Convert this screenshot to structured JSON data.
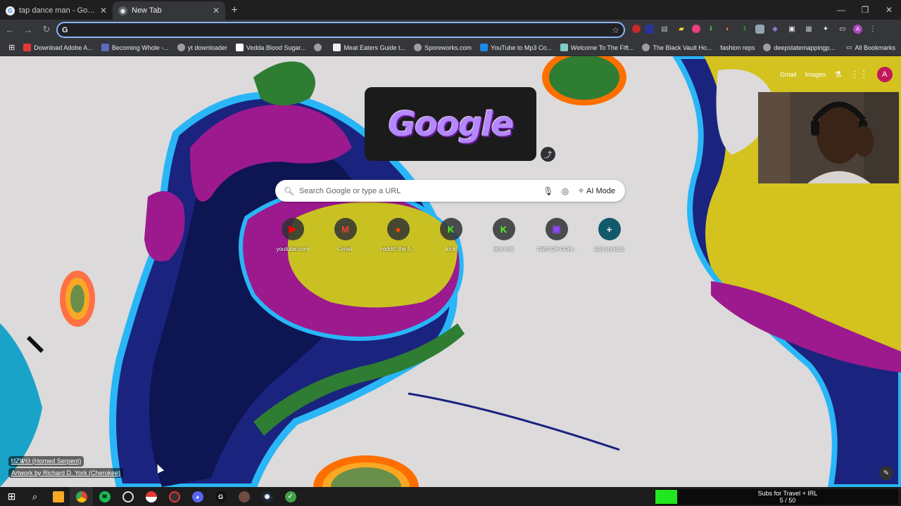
{
  "tabs": [
    {
      "title": "tap dance man - Google Search",
      "active": false
    },
    {
      "title": "New Tab",
      "active": true
    }
  ],
  "omnibox": {
    "value": "",
    "placeholder": ""
  },
  "bookmarks": [
    {
      "label": "Download Adobe A...",
      "color": "#e53935"
    },
    {
      "label": "Becoming Whole -...",
      "color": "#5c6bc0"
    },
    {
      "label": "yt downloader",
      "color": "#9e9e9e"
    },
    {
      "label": "Vedda Blood Sugar...",
      "color": "#ffffff"
    },
    {
      "label": "",
      "color": "#9e9e9e"
    },
    {
      "label": "Meat Eaters Guide t...",
      "color": "#eeeeee"
    },
    {
      "label": "Sporeworks.com",
      "color": "#9e9e9e"
    },
    {
      "label": "YouTube to Mp3 Co...",
      "color": "#1e88e5"
    },
    {
      "label": "Welcome To The Fift...",
      "color": "#80cbc4"
    },
    {
      "label": "The Black Vault Ho...",
      "color": "#9e9e9e"
    },
    {
      "label": "fashion reps",
      "color": ""
    },
    {
      "label": "deepstatemappingp...",
      "color": "#9e9e9e"
    }
  ],
  "all_bookmarks": "All Bookmarks",
  "toplinks": {
    "gmail": "Gmail",
    "images": "Images",
    "avatar": "A"
  },
  "doodle": {
    "text": "Google"
  },
  "search": {
    "placeholder": "Search Google or type a URL",
    "ai_mode": "AI Mode"
  },
  "shortcuts": [
    {
      "label": "youtube.com",
      "glyph": "▶",
      "color": "#ff0000"
    },
    {
      "label": "Gmail",
      "glyph": "M",
      "color": "#ea4335"
    },
    {
      "label": "reddit: the fr...",
      "glyph": "●",
      "color": "#ff4500"
    },
    {
      "label": "kick",
      "glyph": "K",
      "color": "#53fc18"
    },
    {
      "label": "kick chat",
      "glyph": "K",
      "color": "#53fc18"
    },
    {
      "label": "TWITCH CCH...",
      "glyph": "▣",
      "color": "#9146ff"
    },
    {
      "label": "Add shortcut",
      "glyph": "+",
      "color": "#ffffff"
    }
  ],
  "attribution": {
    "title": "ᏌᏃᏔᎾ (Horned Serpent)",
    "artist": "Artwork by Richard D. York (Cherokee)"
  },
  "subs_widget": {
    "line1": "Subs for Travel + IRL",
    "line2": "5 / 50",
    "progress": 0.1,
    "color": "#22e61f"
  }
}
